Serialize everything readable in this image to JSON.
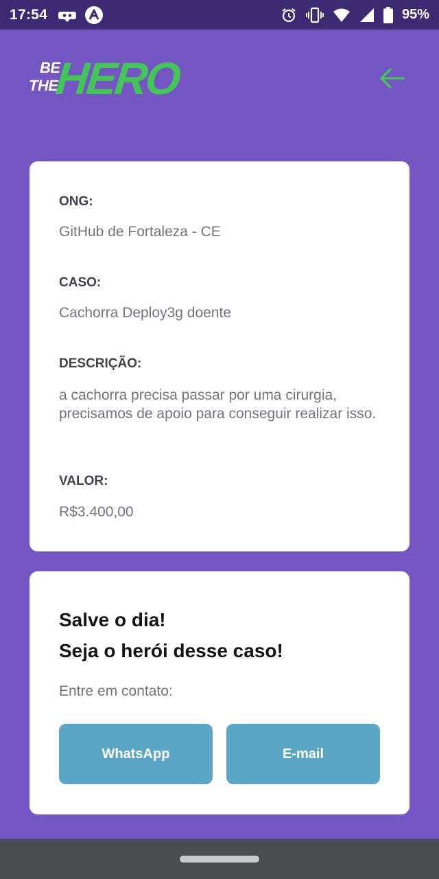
{
  "status_bar": {
    "time": "17:54",
    "battery_percent": "95%",
    "icons_left": [
      "game-controller-icon",
      "app-a-icon"
    ],
    "icons_right": [
      "alarm-icon",
      "vibrate-icon",
      "wifi-icon",
      "signal-icon",
      "battery-icon"
    ]
  },
  "header": {
    "logo": {
      "line1": "BE",
      "line2": "THE",
      "line3": "HERO"
    },
    "back_icon": "arrow-left-icon"
  },
  "case": {
    "ong_label": "ONG:",
    "ong_value": "GitHub de Fortaleza - CE",
    "case_label": "CASO:",
    "case_value": "Cachorra Deploy3g doente",
    "description_label": "DESCRIÇÃO:",
    "description_value": "a cachorra precisa passar por uma cirurgia, precisamos de apoio para conseguir realizar isso.",
    "value_label": "VALOR:",
    "value_value": "R$3.400,00"
  },
  "contact": {
    "title_line1": "Salve o dia!",
    "title_line2": "Seja o herói desse caso!",
    "description": "Entre em contato:",
    "whatsapp_label": "WhatsApp",
    "email_label": "E-mail"
  },
  "colors": {
    "background": "#7356c1",
    "status_bar": "#3d2a73",
    "accent_green": "#45c45a",
    "button": "#5ba6c4",
    "card": "#ffffff"
  }
}
